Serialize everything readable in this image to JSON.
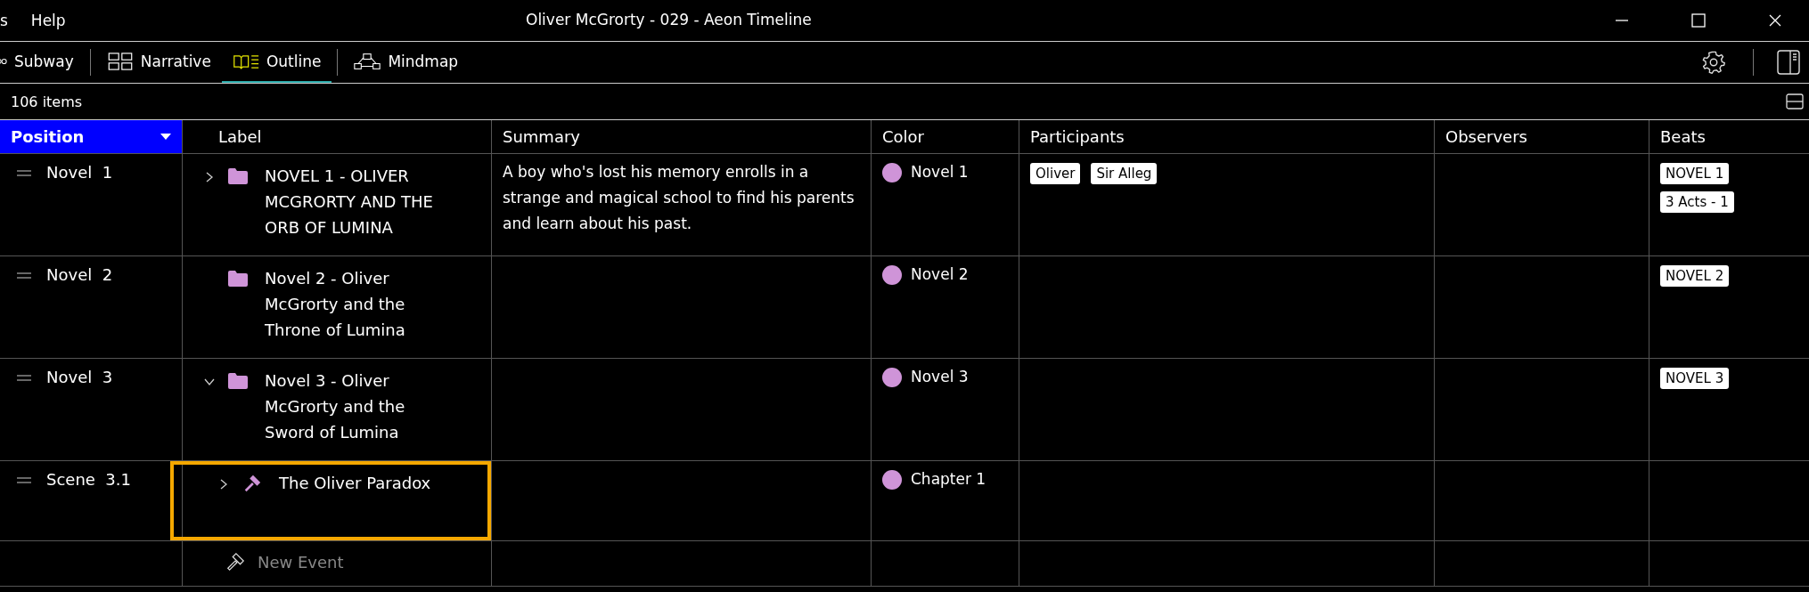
{
  "menu": [
    "s",
    "Help"
  ],
  "window": {
    "title": "Oliver McGrorty - 029 - Aeon Timeline"
  },
  "views": [
    {
      "label": "Subway",
      "kind": "subway",
      "selected": false
    },
    {
      "label": "Narrative",
      "kind": "narrative",
      "selected": false
    },
    {
      "label": "Outline",
      "kind": "outline",
      "selected": true
    },
    {
      "label": "Mindmap",
      "kind": "mindmap",
      "selected": false
    }
  ],
  "item_count": "106 items",
  "columns": [
    {
      "label": "Position",
      "sorted": true
    },
    {
      "label": "Label",
      "sorted": false
    },
    {
      "label": "Summary",
      "sorted": false
    },
    {
      "label": "Color",
      "sorted": false
    },
    {
      "label": "Participants",
      "sorted": false
    },
    {
      "label": "Observers",
      "sorted": false
    },
    {
      "label": "Beats",
      "sorted": false
    }
  ],
  "rows": [
    {
      "type": "Novel",
      "number": "1",
      "label": "NOVEL 1 - OLIVER MCGRORTY AND THE ORB OF LUMINA",
      "kind": "folder",
      "expanded": false,
      "selected": false,
      "summary": "A boy who's lost his memory enrolls in a strange and magical school to find his parents and learn about his past.",
      "color_label": "Novel 1",
      "color": "#cf94d8",
      "participants": [
        "Oliver",
        "Sir Alleg"
      ],
      "beats": [
        "NOVEL 1",
        "3 Acts - 1"
      ]
    },
    {
      "type": "Novel",
      "number": "2",
      "label": "Novel 2 - Oliver McGrorty and the Throne of Lumina",
      "kind": "folder",
      "selected": false,
      "color_label": "Novel 2",
      "color": "#cf94d8",
      "beats": [
        "NOVEL 2"
      ]
    },
    {
      "type": "Novel",
      "number": "3",
      "label": "Novel 3 - Oliver McGrorty and the Sword of Lumina",
      "kind": "folder",
      "expanded": true,
      "selected": false,
      "color_label": "Novel 3",
      "color": "#cf94d8",
      "beats": [
        "NOVEL 3"
      ],
      "children": [
        {
          "type": "Scene",
          "number": "3.1",
          "label": "The Oliver Paradox",
          "kind": "event",
          "expanded": false,
          "selected": true,
          "color_label": "Chapter 1",
          "color": "#cf94d8"
        }
      ]
    }
  ],
  "new_event": {
    "label": "New Event"
  }
}
